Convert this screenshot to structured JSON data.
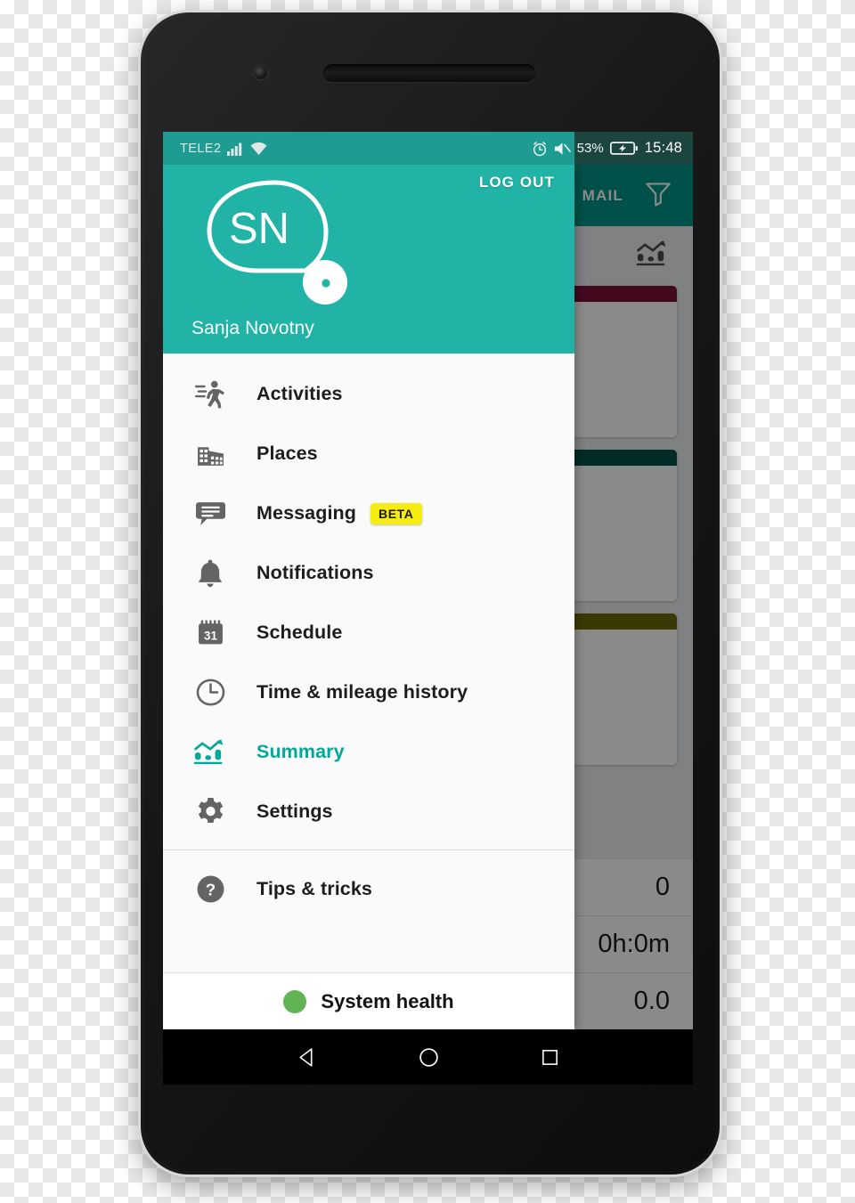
{
  "status_bar": {
    "carrier": "TELE2",
    "signal_icon": "signal-bars-icon",
    "wifi_icon": "wifi-icon",
    "alarm_icon": "alarm-clock-icon",
    "mute_icon": "volume-mute-icon",
    "battery_percent": "53%",
    "battery_icon": "battery-charging-icon",
    "time": "15:48",
    "bg_color_light": "#1f9c91",
    "bg_color_dark": "#1c453f"
  },
  "drawer": {
    "accent_color": "#21b3a6",
    "active_color": "#00a99a",
    "logout_label": "LOG OUT",
    "avatar": {
      "initials": "SN",
      "icon": "location-pin-avatar-icon"
    },
    "user_name": "Sanja Novotny",
    "items": [
      {
        "label": "Activities",
        "icon": "running-person-icon",
        "active": false
      },
      {
        "label": "Places",
        "icon": "building-icon",
        "active": false
      },
      {
        "label": "Messaging",
        "icon": "chat-bubble-icon",
        "active": false,
        "badge": "BETA"
      },
      {
        "label": "Notifications",
        "icon": "bell-icon",
        "active": false
      },
      {
        "label": "Schedule",
        "icon": "calendar-31-icon",
        "active": false
      },
      {
        "label": "Time & mileage history",
        "icon": "clock-icon",
        "active": false
      },
      {
        "label": "Summary",
        "icon": "bar-chart-trend-icon",
        "active": true
      },
      {
        "label": "Settings",
        "icon": "gear-icon",
        "active": false
      }
    ],
    "secondary_items": [
      {
        "label": "Tips & tricks",
        "icon": "question-mark-circle-icon"
      }
    ],
    "system_health": {
      "label": "System health",
      "status_color": "#62b354"
    }
  },
  "background_app": {
    "appbar": {
      "title": "MAIL",
      "filter_icon": "funnel-filter-icon",
      "color": "#009688"
    },
    "toolbar": {
      "chart_icon": "bar-chart-trend-icon"
    },
    "cards": [
      {
        "accent_color": "#7a1038"
      },
      {
        "accent_color": "#005049"
      },
      {
        "accent_color": "#6e6a06"
      }
    ],
    "stats": [
      {
        "value": "0"
      },
      {
        "value": "0h:0m"
      },
      {
        "value": "0.0"
      }
    ]
  },
  "nav_bar": {
    "back_icon": "triangle-back-icon",
    "home_icon": "circle-home-icon",
    "recents_icon": "square-recents-icon"
  }
}
